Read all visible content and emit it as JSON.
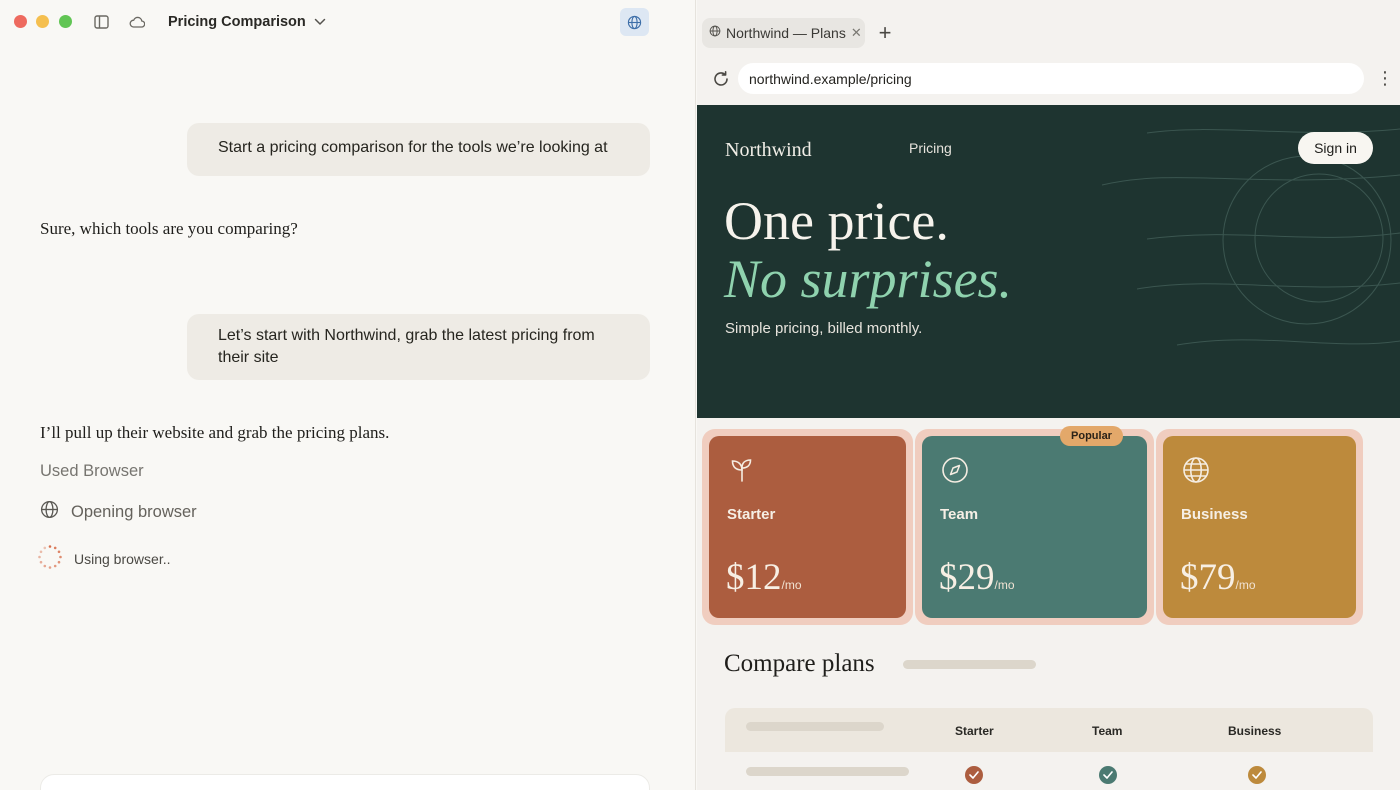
{
  "app": {
    "title": "Pricing Comparison"
  },
  "chat": {
    "messages": [
      {
        "role": "user",
        "text": "Start a pricing comparison for the tools we’re looking at"
      },
      {
        "role": "assistant",
        "text": "Sure, which tools are you comparing?"
      },
      {
        "role": "user",
        "text": "Let’s start with Northwind, grab the latest pricing from their site"
      },
      {
        "role": "assistant",
        "text": "I’ll pull up their website and grab the pricing plans."
      }
    ],
    "tool": {
      "used_label": "Used Browser",
      "step_label": "Opening browser",
      "status_label": "Using browser.."
    }
  },
  "browser": {
    "tab_title": "Northwind — Plans",
    "url": "northwind.example/pricing"
  },
  "site": {
    "logo": "Northwind",
    "nav_pricing": "Pricing",
    "signin": "Sign in",
    "headline": "One price.",
    "headline_accent": "No surprises.",
    "subtitle": "Simple pricing, billed monthly.",
    "popular_badge": "Popular",
    "plans": [
      {
        "name": "Starter",
        "price": "$12",
        "unit": "/mo",
        "icon": "sprout-icon",
        "color": "#ac5d3f"
      },
      {
        "name": "Team",
        "price": "$29",
        "unit": "/mo",
        "icon": "compass-icon",
        "color": "#4b7a72"
      },
      {
        "name": "Business",
        "price": "$79",
        "unit": "/mo",
        "icon": "globe-icon",
        "color": "#bd8a3c"
      }
    ],
    "compare": {
      "title": "Compare plans",
      "columns": [
        "Starter",
        "Team",
        "Business"
      ]
    }
  },
  "colors": {
    "hero_bg": "#1e3430",
    "accent_green": "#8fd2ae",
    "toggle_blue": "#3d6ea8"
  }
}
